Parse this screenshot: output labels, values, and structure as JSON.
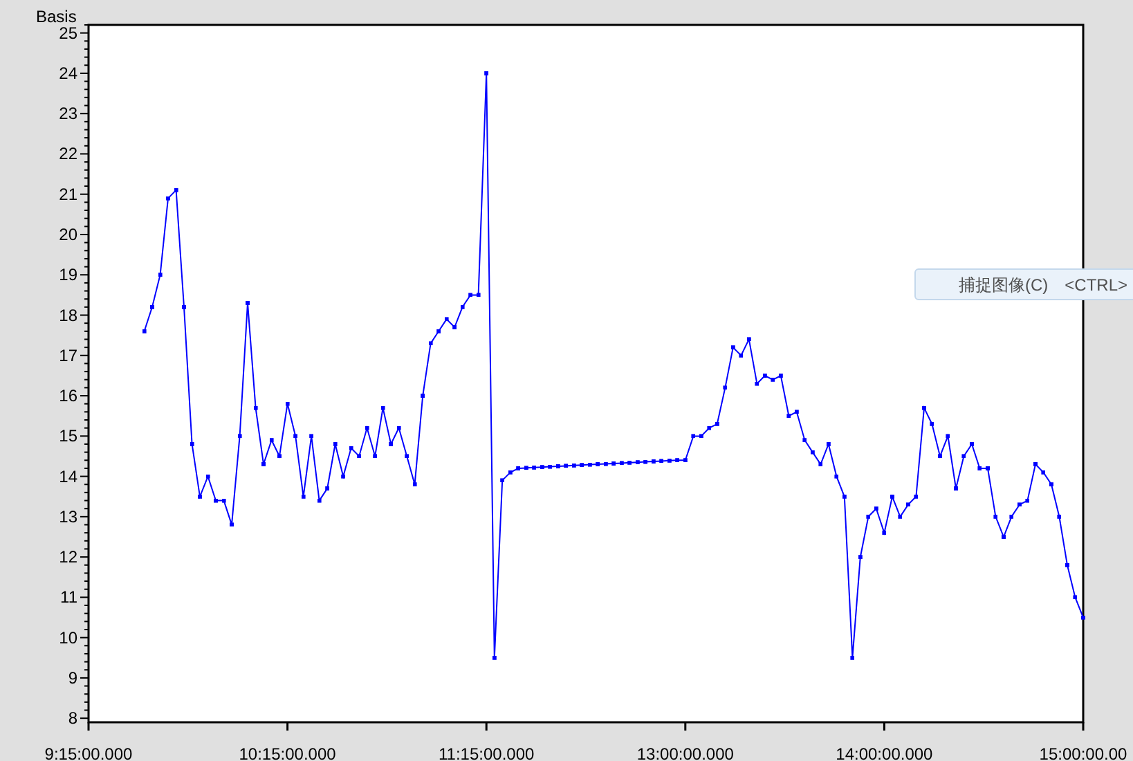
{
  "chart": {
    "chart_data": {
      "type": "line",
      "ylabel": "Basis",
      "ylim": [
        7.9,
        25.2
      ],
      "yticks": [
        8,
        9,
        10,
        11,
        12,
        13,
        14,
        15,
        16,
        17,
        18,
        19,
        20,
        21,
        22,
        23,
        24,
        25
      ],
      "categories": [
        "9:15:00.000",
        null,
        null,
        null,
        null,
        null,
        null,
        null,
        null,
        null,
        null,
        null,
        null,
        null,
        null,
        null,
        null,
        null,
        null,
        null,
        null,
        null,
        null,
        null,
        null,
        "10:15:00.000",
        null,
        null,
        null,
        null,
        null,
        null,
        null,
        null,
        null,
        null,
        null,
        null,
        null,
        null,
        null,
        null,
        null,
        null,
        null,
        null,
        null,
        null,
        null,
        null,
        "11:15:00.000",
        null,
        null,
        null,
        null,
        null,
        null,
        null,
        null,
        null,
        null,
        null,
        null,
        null,
        null,
        null,
        null,
        null,
        null,
        null,
        null,
        null,
        null,
        null,
        null,
        "13:00:00.000",
        null,
        null,
        null,
        null,
        null,
        null,
        null,
        null,
        null,
        null,
        null,
        null,
        null,
        null,
        null,
        null,
        null,
        null,
        null,
        null,
        null,
        null,
        null,
        null,
        "14:00:00.000",
        null,
        null,
        null,
        null,
        null,
        null,
        null,
        null,
        null,
        null,
        null,
        null,
        null,
        null,
        null,
        null,
        null,
        null,
        null,
        null,
        null,
        null,
        null,
        null,
        "15:00:00.00"
      ],
      "series": [
        {
          "color": "#0000ff",
          "values": [
            null,
            null,
            null,
            null,
            null,
            null,
            null,
            17.6,
            18.2,
            19,
            20.9,
            21.1,
            18.2,
            14.8,
            13.5,
            14,
            13.4,
            13.4,
            12.8,
            15,
            18.3,
            15.7,
            14.3,
            14.9,
            14.5,
            15.8,
            15,
            13.5,
            15,
            13.4,
            13.7,
            14.8,
            14,
            14.7,
            14.5,
            15.2,
            14.5,
            15.7,
            14.8,
            15.2,
            14.5,
            13.8,
            16,
            17.3,
            17.6,
            17.9,
            17.7,
            18.2,
            18.5,
            18.5,
            24,
            9.5,
            13.9,
            14.1,
            14.2,
            14.21,
            14.22,
            14.23,
            14.24,
            14.25,
            14.26,
            14.27,
            14.28,
            14.29,
            14.3,
            14.31,
            14.32,
            14.33,
            14.34,
            14.35,
            14.36,
            14.37,
            14.38,
            14.39,
            14.4,
            14.4,
            15,
            15,
            15.2,
            15.3,
            16.2,
            17.2,
            17,
            17.4,
            16.3,
            16.5,
            16.4,
            16.5,
            15.5,
            15.6,
            14.9,
            14.6,
            14.3,
            14.8,
            14,
            13.5,
            9.5,
            12,
            13,
            13.2,
            12.6,
            13.5,
            13,
            13.3,
            13.5,
            15.7,
            15.3,
            14.5,
            15,
            13.7,
            14.5,
            14.8,
            14.2,
            14.2,
            13,
            12.5,
            13,
            13.3,
            13.4,
            14.3,
            14.1,
            13.8,
            13,
            11.8,
            11,
            10.5
          ]
        }
      ]
    }
  },
  "context_menu": {
    "items": [
      {
        "label": "捕捉图像(C)",
        "shortcut": "<CTRL>"
      }
    ]
  }
}
